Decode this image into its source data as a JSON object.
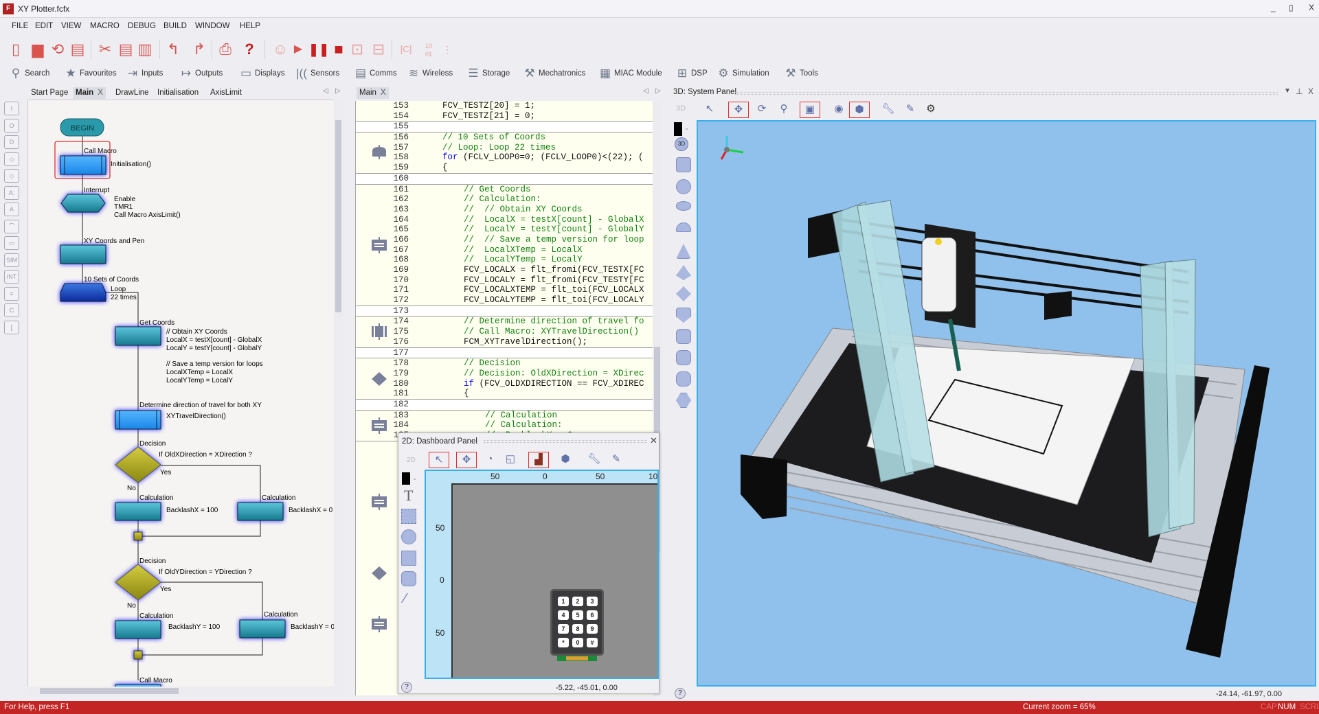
{
  "window": {
    "title": "XY Plotter.fcfx",
    "app_icon": "flowcode-logo",
    "controls": [
      "_",
      "▯",
      "X"
    ]
  },
  "menu": [
    "FILE",
    "EDIT",
    "VIEW",
    "MACRO",
    "DEBUG",
    "BUILD",
    "WINDOW",
    "HELP"
  ],
  "toolbar_icons": [
    "new-file-icon",
    "open-icon",
    "reload-icon",
    "save-icon",
    "cut-icon",
    "copy-icon",
    "paste-icon",
    "undo-icon",
    "redo-icon",
    "print-icon",
    "help-icon",
    "ghost-icon",
    "play-icon",
    "pause-icon",
    "stop-icon",
    "step-into-icon",
    "step-over-icon",
    "compile-c-icon",
    "compile-hex-icon"
  ],
  "component_toolbar": [
    {
      "label": "Search",
      "icon": "search-icon"
    },
    {
      "label": "Favourites",
      "icon": "star-icon"
    },
    {
      "label": "Inputs",
      "icon": "inputs-icon"
    },
    {
      "label": "Outputs",
      "icon": "outputs-icon"
    },
    {
      "label": "Displays",
      "icon": "display-icon"
    },
    {
      "label": "Sensors",
      "icon": "sensors-icon"
    },
    {
      "label": "Comms",
      "icon": "comms-icon"
    },
    {
      "label": "Wireless",
      "icon": "wireless-icon"
    },
    {
      "label": "Storage",
      "icon": "storage-icon"
    },
    {
      "label": "Mechatronics",
      "icon": "robot-arm-icon"
    },
    {
      "label": "MIAC Module",
      "icon": "miac-icon"
    },
    {
      "label": "DSP",
      "icon": "dsp-icon"
    },
    {
      "label": "Simulation",
      "icon": "gear-icon"
    },
    {
      "label": "Tools",
      "icon": "tools-icon"
    }
  ],
  "flow_tabs": [
    {
      "label": "Start Page"
    },
    {
      "label": "Main",
      "active": true,
      "close": "X"
    },
    {
      "label": "DrawLine"
    },
    {
      "label": "Initialisation"
    },
    {
      "label": "AxisLimit"
    }
  ],
  "left_tools": [
    "I",
    "O",
    "D",
    "◇",
    "◇",
    "A:",
    "A",
    "⌒",
    "▭",
    "SIM",
    "INT",
    "≡",
    "C",
    "["
  ],
  "flowchart": {
    "begin": "BEGIN",
    "call1": {
      "title": "Call Macro",
      "text": "Initialisation()"
    },
    "interrupt": {
      "title": "Interrupt",
      "lines": [
        "Enable",
        "TMR1",
        "Call Macro AxisLimit()"
      ]
    },
    "calc1": {
      "title": "XY Coords and Pen"
    },
    "loop": {
      "title": "10 Sets of Coords",
      "lines": [
        "Loop",
        "22 times"
      ]
    },
    "calc2": {
      "title": "Get Coords",
      "lines": [
        "// Obtain XY Coords",
        "LocalX = testX[count] - GlobalX",
        "LocalY = testY[count] - GlobalY",
        "// Save a temp version for loops",
        "LocalXTemp = LocalX",
        "LocalYTemp = LocalY"
      ]
    },
    "call2": {
      "title": "Determine direction of travel for both XY",
      "text": "XYTravelDirection()"
    },
    "dec1": {
      "title": "Decision",
      "cond": "If  OldXDirection = XDirection ?",
      "yes": "Yes",
      "no": "No",
      "left": {
        "title": "Calculation",
        "text": "BacklashX = 100"
      },
      "right": {
        "title": "Calculation",
        "text": "BacklashX = 0"
      }
    },
    "dec2": {
      "title": "Decision",
      "cond": "If  OldYDirection = YDirection ?",
      "yes": "Yes",
      "no": "No",
      "left": {
        "title": "Calculation",
        "text": "BacklashY = 100"
      },
      "right": {
        "title": "Calculation",
        "text": "BacklashY = 0"
      }
    },
    "call3": {
      "title": "Call Macro"
    }
  },
  "code_tab": {
    "label": "Main",
    "close": "X"
  },
  "code_blocks": [
    {
      "icon": "",
      "lines": [
        {
          "n": "153",
          "i": 0,
          "p": [
            [
              "FCV_TESTZ[20] = 1;",
              "tx"
            ]
          ]
        },
        {
          "n": "154",
          "i": 0,
          "p": [
            [
              "FCV_TESTZ[21] = 0;",
              "tx"
            ]
          ]
        }
      ]
    },
    {
      "sep": true,
      "lines": [
        {
          "n": "155",
          "i": 0,
          "p": []
        }
      ]
    },
    {
      "icon": "loop",
      "lines": [
        {
          "n": "156",
          "i": 0,
          "p": [
            [
              "// 10 Sets of Coords",
              "cm"
            ]
          ]
        },
        {
          "n": "157",
          "i": 0,
          "p": [
            [
              "// Loop: Loop 22 times",
              "cm"
            ]
          ]
        },
        {
          "n": "158",
          "i": 0,
          "p": [
            [
              "for",
              "kw"
            ],
            [
              " (FCLV_LOOP0=0; (FCLV_LOOP0)<(22); (",
              "tx"
            ]
          ]
        },
        {
          "n": "159",
          "i": 0,
          "p": [
            [
              "{",
              "tx"
            ]
          ]
        }
      ]
    },
    {
      "sep": true,
      "lines": [
        {
          "n": "160",
          "i": 0,
          "p": []
        }
      ]
    },
    {
      "icon": "calc",
      "lines": [
        {
          "n": "161",
          "i": 1,
          "p": [
            [
              "// Get Coords",
              "cm"
            ]
          ]
        },
        {
          "n": "162",
          "i": 1,
          "p": [
            [
              "// Calculation:",
              "cm"
            ]
          ]
        },
        {
          "n": "163",
          "i": 1,
          "p": [
            [
              "//  // Obtain XY Coords",
              "cm"
            ]
          ]
        },
        {
          "n": "164",
          "i": 1,
          "p": [
            [
              "//  LocalX = testX[count] - GlobalX",
              "cm"
            ]
          ]
        },
        {
          "n": "165",
          "i": 1,
          "p": [
            [
              "//  LocalY = testY[count] - GlobalY",
              "cm"
            ]
          ]
        },
        {
          "n": "166",
          "i": 1,
          "p": [
            [
              "//  // Save a temp version for loop",
              "cm"
            ]
          ]
        },
        {
          "n": "167",
          "i": 1,
          "p": [
            [
              "//  LocalXTemp = LocalX",
              "cm"
            ]
          ]
        },
        {
          "n": "168",
          "i": 1,
          "p": [
            [
              "//  LocalYTemp = LocalY",
              "cm"
            ]
          ]
        },
        {
          "n": "169",
          "i": 1,
          "p": [
            [
              "FCV_LOCALX = flt_fromi(FCV_TESTX[FC",
              "tx"
            ]
          ]
        },
        {
          "n": "170",
          "i": 1,
          "p": [
            [
              "FCV_LOCALY = flt_fromi(FCV_TESTY[FC",
              "tx"
            ]
          ]
        },
        {
          "n": "171",
          "i": 1,
          "p": [
            [
              "FCV_LOCALXTEMP = flt_toi(FCV_LOCALX",
              "tx"
            ]
          ]
        },
        {
          "n": "172",
          "i": 1,
          "p": [
            [
              "FCV_LOCALYTEMP = flt_toi(FCV_LOCALY",
              "tx"
            ]
          ]
        }
      ]
    },
    {
      "sep": true,
      "lines": [
        {
          "n": "173",
          "i": 0,
          "p": []
        }
      ]
    },
    {
      "icon": "macro",
      "lines": [
        {
          "n": "174",
          "i": 1,
          "p": [
            [
              "// Determine direction of travel fo",
              "cm"
            ]
          ]
        },
        {
          "n": "175",
          "i": 1,
          "p": [
            [
              "// Call Macro: XYTravelDirection()",
              "cm"
            ]
          ]
        },
        {
          "n": "176",
          "i": 1,
          "p": [
            [
              "FCM_XYTravelDirection();",
              "tx"
            ]
          ]
        }
      ]
    },
    {
      "sep": true,
      "lines": [
        {
          "n": "177",
          "i": 0,
          "p": []
        }
      ]
    },
    {
      "icon": "decision",
      "lines": [
        {
          "n": "178",
          "i": 1,
          "p": [
            [
              "// Decision",
              "cm"
            ]
          ]
        },
        {
          "n": "179",
          "i": 1,
          "p": [
            [
              "// Decision: OldXDirection = XDirec",
              "cm"
            ]
          ]
        },
        {
          "n": "180",
          "i": 1,
          "p": [
            [
              "if",
              "kw"
            ],
            [
              " (FCV_OLDXDIRECTION == FCV_XDIREC",
              "tx"
            ]
          ]
        },
        {
          "n": "181",
          "i": 1,
          "p": [
            [
              "{",
              "tx"
            ]
          ]
        }
      ]
    },
    {
      "sep": true,
      "lines": [
        {
          "n": "182",
          "i": 0,
          "p": []
        }
      ]
    },
    {
      "icon": "calc",
      "lines": [
        {
          "n": "183",
          "i": 2,
          "p": [
            [
              "// Calculation",
              "cm"
            ]
          ]
        },
        {
          "n": "184",
          "i": 2,
          "p": [
            [
              "// Calculation:",
              "cm"
            ]
          ]
        },
        {
          "n": "185",
          "i": 2,
          "p": [
            [
              "//  BacklashX = 0",
              "cm"
            ]
          ]
        }
      ]
    }
  ],
  "panel3d": {
    "title": "3D: System Panel",
    "mode": "3D",
    "tools": [
      "pointer-icon",
      "pan-icon",
      "orbit-icon",
      "zoom-icon",
      "camera-icon",
      "ground-icon",
      "solid-icon",
      "wrench-icon",
      "paint-icon",
      "camera-settings-icon"
    ],
    "active_tools": [
      "pan-icon",
      "camera-icon",
      "solid-icon"
    ],
    "coords": "-24.14, -61.97, 0.00",
    "background": "#90c1ec"
  },
  "dashboard": {
    "title": "2D: Dashboard Panel",
    "mode": "2D",
    "close": "✕",
    "ruler_top": [
      "50",
      "0",
      "50",
      "10"
    ],
    "ruler_left": [
      "50",
      "0",
      "50"
    ],
    "keys": [
      "1",
      "2",
      "3",
      "4",
      "5",
      "6",
      "7",
      "8",
      "9",
      "*",
      "0",
      "#"
    ],
    "coords": "-5.22, -45.01, 0.00"
  },
  "statusbar": {
    "help": "For Help, press F1",
    "zoom": "Current zoom = 65%",
    "cap": "CAP",
    "num": "NUM",
    "scrl": "SCRL",
    "color": "#c22523"
  }
}
